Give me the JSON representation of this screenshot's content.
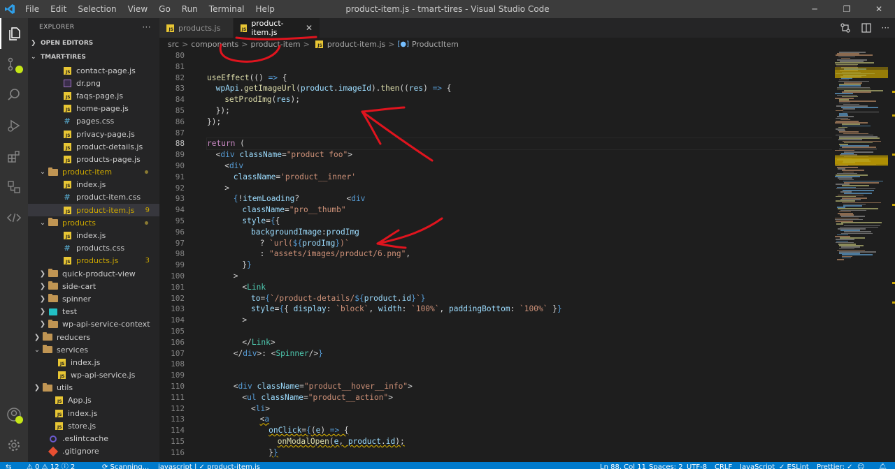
{
  "window": {
    "title": "product-item.js - tmart-tires - Visual Studio Code",
    "menu": [
      "File",
      "Edit",
      "Selection",
      "View",
      "Go",
      "Run",
      "Terminal",
      "Help"
    ],
    "controls": {
      "minimize": "─",
      "restore": "❐",
      "close": "✕"
    }
  },
  "explorer": {
    "header": "EXPLORER",
    "more": "···",
    "open_editors": "OPEN EDITORS",
    "project": "TMART-TIRES",
    "rows": [
      {
        "label": "contact-page.js",
        "icon": "js"
      },
      {
        "label": "dr.png",
        "icon": "img"
      },
      {
        "label": "faqs-page.js",
        "icon": "js"
      },
      {
        "label": "home-page.js",
        "icon": "js"
      },
      {
        "label": "pages.css",
        "icon": "css"
      },
      {
        "label": "privacy-page.js",
        "icon": "js"
      },
      {
        "label": "product-details.js",
        "icon": "js"
      },
      {
        "label": "products-page.js",
        "icon": "js"
      },
      {
        "label": "product-item",
        "icon": "folder-open"
      },
      {
        "label": "index.js",
        "icon": "js"
      },
      {
        "label": "product-item.css",
        "icon": "css"
      },
      {
        "label": "product-item.js",
        "icon": "js",
        "badge": "9"
      },
      {
        "label": "products",
        "icon": "folder-open"
      },
      {
        "label": "index.js",
        "icon": "js"
      },
      {
        "label": "products.css",
        "icon": "css"
      },
      {
        "label": "products.js",
        "icon": "js",
        "badge": "3"
      },
      {
        "label": "quick-product-view",
        "icon": "folder"
      },
      {
        "label": "side-cart",
        "icon": "folder"
      },
      {
        "label": "spinner",
        "icon": "folder"
      },
      {
        "label": "test",
        "icon": "test"
      },
      {
        "label": "wp-api-service-context",
        "icon": "folder"
      },
      {
        "label": "reducers",
        "icon": "folder"
      },
      {
        "label": "services",
        "icon": "folder-open"
      },
      {
        "label": "index.js",
        "icon": "js"
      },
      {
        "label": "wp-api-service.js",
        "icon": "js"
      },
      {
        "label": "utils",
        "icon": "folder"
      },
      {
        "label": "App.js",
        "icon": "js"
      },
      {
        "label": "index.js",
        "icon": "js"
      },
      {
        "label": "store.js",
        "icon": "js"
      },
      {
        "label": ".eslintcache",
        "icon": "eslint"
      },
      {
        "label": ".gitignore",
        "icon": "git"
      }
    ]
  },
  "tabs": [
    {
      "label": "products.js",
      "icon": "js"
    },
    {
      "label": "product-item.js",
      "icon": "js",
      "close": "✕"
    }
  ],
  "breadcrumb": {
    "parts": [
      "src",
      "components",
      "product-item",
      "product-item.js",
      "ProductItem"
    ],
    "sep": ">",
    "js_icon_text": "JS",
    "symbol_icon": "[●]"
  },
  "editor": {
    "line_numbers": [
      "80",
      "81",
      "82",
      "83",
      "84",
      "85",
      "86",
      "87",
      "88",
      "89",
      "90",
      "91",
      "92",
      "93",
      "94",
      "95",
      "96",
      "97",
      "98",
      "99",
      "100",
      "101",
      "102",
      "103",
      "104",
      "105",
      "106",
      "107",
      "108",
      "109",
      "110",
      "111",
      "112",
      "113",
      "114",
      "115",
      "116"
    ],
    "current_line": "88"
  },
  "colors": {
    "accent": "#007acc",
    "annotation": "#e0141e",
    "warning": "#cca700"
  },
  "statusbar": {
    "items": [
      "⚠ 0  ⚠ 12  ⓘ 2",
      "⟳ Scanning...",
      "javascript | ✓ product-item.js",
      "Ln 88, Col 11",
      "Spaces: 2",
      "UTF-8",
      "CRLF",
      "JavaScript",
      "✓ ESLint",
      "Prettier: ✓"
    ]
  }
}
